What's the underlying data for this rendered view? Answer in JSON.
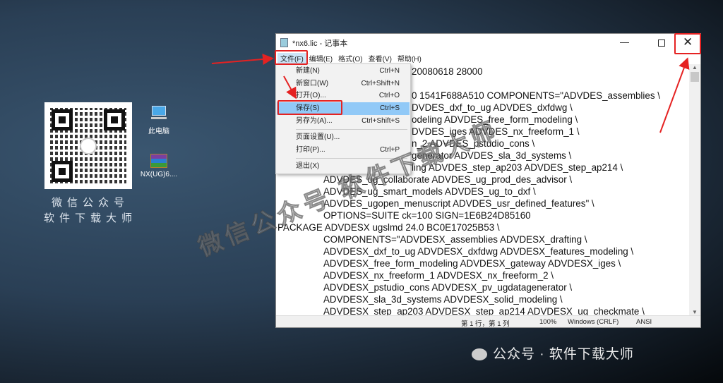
{
  "desktop": {
    "qr_caption_1": "微信公众号",
    "qr_caption_2": "软件下载大师",
    "icons": [
      {
        "label": "此电脑",
        "icon": "computer-icon"
      },
      {
        "label": "NX(UG)6....",
        "icon": "winrar-archive-icon"
      }
    ],
    "watermark": "微信公众号 软件下载大师",
    "footer": "公众号 · 软件下载大师"
  },
  "notepad": {
    "title": "*nx6.lic - 记事本",
    "menu": [
      "文件(F)",
      "编辑(E)",
      "格式(O)",
      "查看(V)",
      "帮助(H)"
    ],
    "lines": [
      {
        "t": "20080618 28000",
        "i": "f"
      },
      {
        "t": "",
        "i": "f"
      },
      {
        "t": "0 1541F688A510 COMPONENTS=\"ADVDES_assemblies \\",
        "i": "f"
      },
      {
        "t": "DVDES_dxf_to_ug ADVDES_dxfdwg \\",
        "i": "f"
      },
      {
        "t": "odeling ADVDES_free_form_modeling \\",
        "i": "f"
      },
      {
        "t": "DVDES_iges ADVDES_nx_freeform_1 \\",
        "i": "f"
      },
      {
        "t": "n_2 ADVDES_pstudio_cons \\",
        "i": "f"
      },
      {
        "t": "generator ADVDES_sla_3d_systems \\",
        "i": "f"
      },
      {
        "t": "ling ADVDES_step_ap203 ADVDES_step_ap214 \\",
        "i": "f"
      },
      {
        "t": "ADVDES_ug_collaborate ADVDES_ug_prod_des_advisor \\",
        "i": "i"
      },
      {
        "t": "ADVDES_ug_smart_models ADVDES_ug_to_dxf \\",
        "i": "i"
      },
      {
        "t": "ADVDES_ugopen_menuscript ADVDES_usr_defined_features\" \\",
        "i": "i"
      },
      {
        "t": "OPTIONS=SUITE ck=100 SIGN=1E6B24D85160",
        "i": "i"
      },
      {
        "t": "PACKAGE ADVDESX ugslmd 24.0 BC0E17025B53 \\",
        "i": "n"
      },
      {
        "t": "COMPONENTS=\"ADVDESX_assemblies ADVDESX_drafting \\",
        "i": "i"
      },
      {
        "t": "ADVDESX_dxf_to_ug ADVDESX_dxfdwg ADVDESX_features_modeling \\",
        "i": "i"
      },
      {
        "t": "ADVDESX_free_form_modeling ADVDESX_gateway ADVDESX_iges \\",
        "i": "i"
      },
      {
        "t": "ADVDESX_nx_freeform_1 ADVDESX_nx_freeform_2 \\",
        "i": "i"
      },
      {
        "t": "ADVDESX_pstudio_cons ADVDESX_pv_ugdatagenerator \\",
        "i": "i"
      },
      {
        "t": "ADVDESX_sla_3d_systems ADVDESX_solid_modeling \\",
        "i": "i"
      },
      {
        "t": "ADVDESX_step_ap203 ADVDESX_step_ap214 ADVDESX_ug_checkmate \\",
        "i": "i"
      }
    ],
    "status": {
      "position": "第 1 行，第 1 列",
      "zoom": "100%",
      "eol": "Windows (CRLF)",
      "encoding": "ANSI"
    }
  },
  "file_menu": [
    {
      "label": "新建(N)",
      "shortcut": "Ctrl+N"
    },
    {
      "label": "新窗口(W)",
      "shortcut": "Ctrl+Shift+N"
    },
    {
      "label": "打开(O)...",
      "shortcut": "Ctrl+O"
    },
    {
      "label": "保存(S)",
      "shortcut": "Ctrl+S"
    },
    {
      "label": "另存为(A)...",
      "shortcut": "Ctrl+Shift+S"
    },
    {
      "label": "页面设置(U)...",
      "shortcut": ""
    },
    {
      "label": "打印(P)...",
      "shortcut": "Ctrl+P"
    },
    {
      "label": "退出(X)",
      "shortcut": ""
    }
  ],
  "colors": {
    "highlight": "#e52222",
    "menu_hover": "#91c9f7"
  }
}
